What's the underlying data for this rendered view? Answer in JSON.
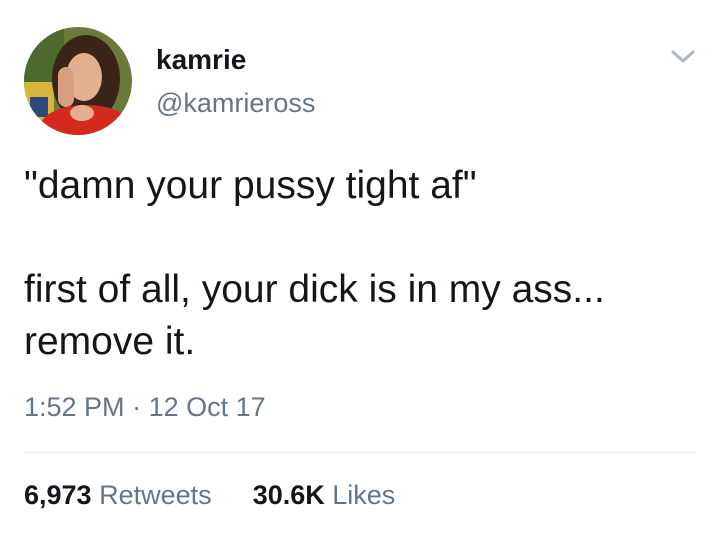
{
  "author": {
    "display_name": "kamrie",
    "handle": "@kamrieross"
  },
  "icons": {
    "menu": "chevron-down-icon"
  },
  "tweet": {
    "lines": [
      "\"damn your pussy tight af\"",
      "first of all, your dick is in my ass...",
      "remove it."
    ]
  },
  "meta": {
    "time": "1:52 PM",
    "separator": "·",
    "date": "12 Oct 17"
  },
  "stats": {
    "retweets_count": "6,973",
    "retweets_label": "Retweets",
    "likes_count": "30.6K",
    "likes_label": "Likes"
  },
  "colors": {
    "text_primary": "#14171a",
    "text_secondary": "#657786",
    "divider": "#e1e8ed"
  }
}
